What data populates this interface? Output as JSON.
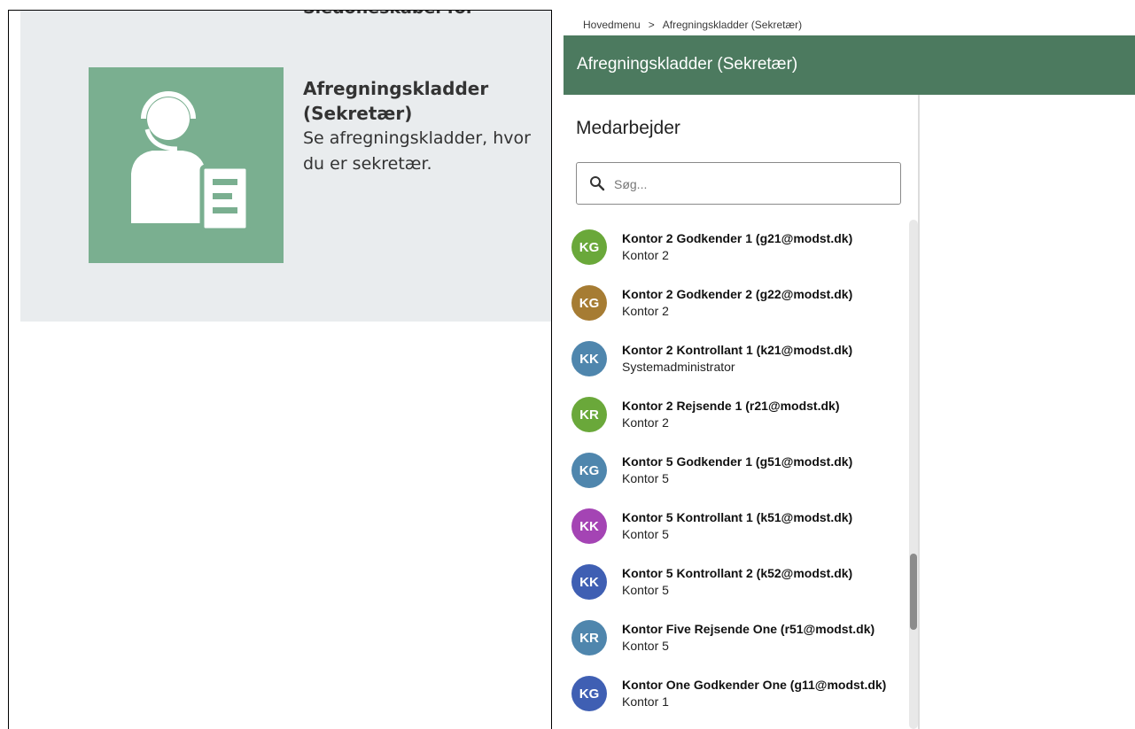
{
  "tile": {
    "cut_text": "Sledoneskabel for",
    "title": "Afregningskladder (Sekretær)",
    "description": "Se afregningskladder, hvor du er sekretær.",
    "icon": "person-document-icon",
    "color": "#7aaf90"
  },
  "breadcrumb": {
    "root": "Hovedmenu",
    "separator": ">",
    "current": "Afregningskladder (Sekretær)"
  },
  "header": {
    "title": "Afregningskladder (Sekretær)",
    "color": "#4c7a5f"
  },
  "panel": {
    "title": "Medarbejder",
    "search": {
      "placeholder": "Søg...",
      "value": "",
      "icon": "search-icon"
    }
  },
  "employees": [
    {
      "initials": "KG",
      "name": "Kontor 2 Godkender 1 (g21@modst.dk)",
      "sub": "Kontor 2",
      "color": "#6aa83a"
    },
    {
      "initials": "KG",
      "name": "Kontor 2 Godkender 2 (g22@modst.dk)",
      "sub": "Kontor 2",
      "color": "#a67c33"
    },
    {
      "initials": "KK",
      "name": "Kontor 2 Kontrollant 1 (k21@modst.dk)",
      "sub": "Systemadministrator",
      "color": "#4f86ad"
    },
    {
      "initials": "KR",
      "name": "Kontor 2 Rejsende 1 (r21@modst.dk)",
      "sub": "Kontor 2",
      "color": "#6aa83a"
    },
    {
      "initials": "KG",
      "name": "Kontor 5 Godkender 1 (g51@modst.dk)",
      "sub": "Kontor 5",
      "color": "#4f86ad"
    },
    {
      "initials": "KK",
      "name": "Kontor 5 Kontrollant 1 (k51@modst.dk)",
      "sub": "Kontor 5",
      "color": "#a444b4"
    },
    {
      "initials": "KK",
      "name": "Kontor 5 Kontrollant 2 (k52@modst.dk)",
      "sub": "Kontor 5",
      "color": "#3f5fb3"
    },
    {
      "initials": "KR",
      "name": "Kontor Five Rejsende One (r51@modst.dk)",
      "sub": "Kontor 5",
      "color": "#4f86ad"
    },
    {
      "initials": "KG",
      "name": "Kontor One Godkender One (g11@modst.dk)",
      "sub": "Kontor 1",
      "color": "#3f5fb3"
    }
  ]
}
